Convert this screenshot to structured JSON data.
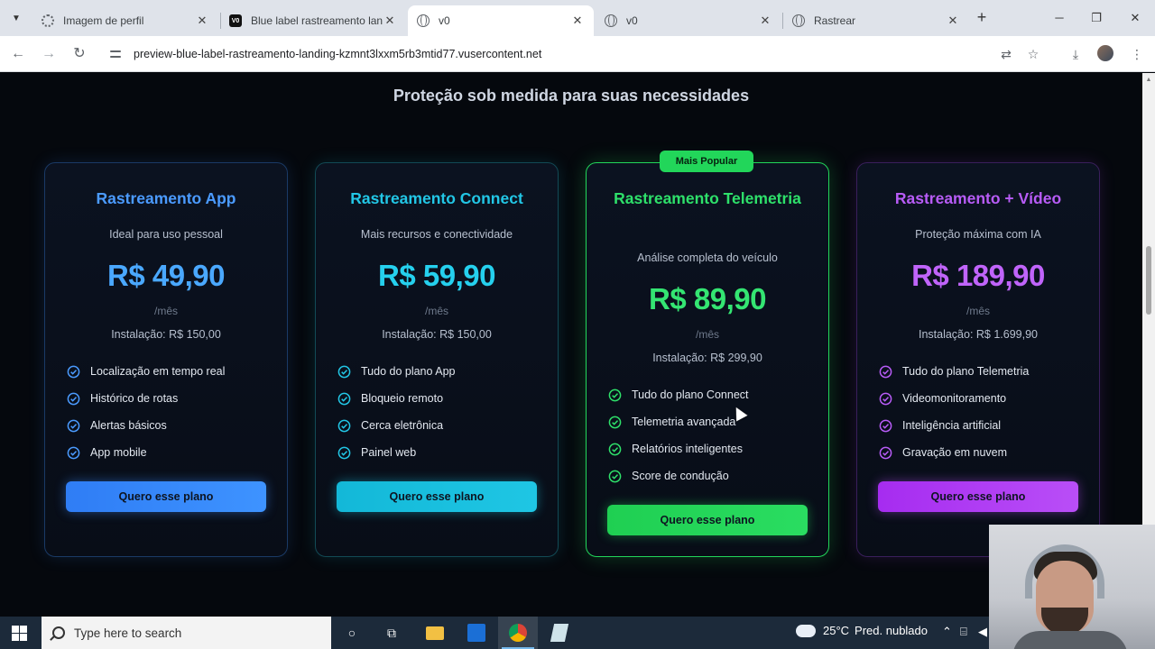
{
  "browser": {
    "tabs": [
      {
        "title": "Imagem de perfil",
        "icon": "gear-icon",
        "active": false
      },
      {
        "title": "Blue label rastreamento landi",
        "icon": "v0-icon",
        "active": false
      },
      {
        "title": "v0",
        "icon": "globe-icon",
        "active": true
      },
      {
        "title": "v0",
        "icon": "globe-icon",
        "active": false
      },
      {
        "title": "Rastrear",
        "icon": "globe-icon",
        "active": false
      }
    ],
    "url": "preview-blue-label-rastreamento-landing-kzmnt3lxxm5rb3mtid77.vusercontent.net"
  },
  "page": {
    "section_title": "Proteção sob medida para suas necessidades",
    "badge": "Mais Popular",
    "plans": [
      {
        "name": "Rastreamento App",
        "tagline": "Ideal para uso pessoal",
        "price": "R$ 49,90",
        "period": "/mês",
        "install": "Instalação: R$ 150,00",
        "features": [
          "Localização em tempo real",
          "Histórico de rotas",
          "Alertas básicos",
          "App mobile"
        ],
        "cta": "Quero esse plano",
        "accent": "#3b8cff"
      },
      {
        "name": "Rastreamento Connect",
        "tagline": "Mais recursos e conectividade",
        "price": "R$ 59,90",
        "period": "/mês",
        "install": "Instalação: R$ 150,00",
        "features": [
          "Tudo do plano App",
          "Bloqueio remoto",
          "Cerca eletrônica",
          "Painel web"
        ],
        "cta": "Quero esse plano",
        "accent": "#19c3e0"
      },
      {
        "name": "Rastreamento Telemetria",
        "tagline": "Análise completa do veículo",
        "price": "R$ 89,90",
        "period": "/mês",
        "install": "Instalação: R$ 299,90",
        "features": [
          "Tudo do plano Connect",
          "Telemetria avançada",
          "Relatórios inteligentes",
          "Score de condução"
        ],
        "cta": "Quero esse plano",
        "accent": "#22d65a"
      },
      {
        "name": "Rastreamento + Vídeo",
        "tagline": "Proteção máxima com IA",
        "price": "R$ 189,90",
        "period": "/mês",
        "install": "Instalação: R$ 1.699,90",
        "features": [
          "Tudo do plano Telemetria",
          "Videomonitoramento",
          "Inteligência artificial",
          "Gravação em nuvem"
        ],
        "cta": "Quero esse plano",
        "accent": "#b24cf5"
      }
    ]
  },
  "taskbar": {
    "search_placeholder": "Type here to search",
    "temperature": "25°C",
    "weather": "Pred. nublado"
  }
}
